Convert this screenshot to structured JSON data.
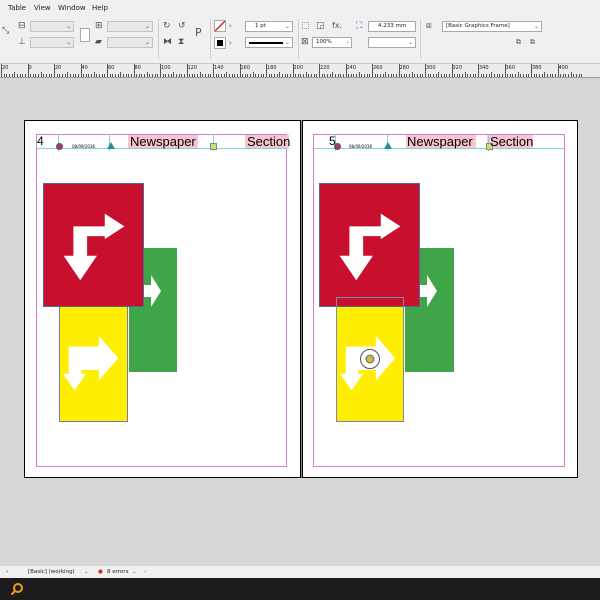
{
  "menu": {
    "items": [
      "Table",
      "View",
      "Window",
      "Help"
    ]
  },
  "control": {
    "stroke_weight": "1 pt",
    "opacity": "100%",
    "dimension": "4.233 mm",
    "object_style": "[Basic Graphics Frame]",
    "fx_label": "fx.",
    "para_glyph": "P"
  },
  "ruler": {
    "ticks": [
      "20",
      "0",
      "20",
      "40",
      "60",
      "80",
      "100",
      "120",
      "140",
      "160",
      "180",
      "200",
      "220",
      "240",
      "260",
      "280",
      "300",
      "320",
      "340",
      "360",
      "380",
      "400"
    ]
  },
  "pages": [
    {
      "number": "4",
      "date": "08/09/2036",
      "title": "Newspaper",
      "section": "Section"
    },
    {
      "number": "5",
      "date": "08/09/2036",
      "title": "Newspaper",
      "section": "Section"
    }
  ],
  "colors": {
    "red": "#c8102e",
    "green": "#3fa548",
    "yellow": "#ffee00",
    "header_highlight": "#f5c6cf",
    "margin_guide": "#d77bd7"
  },
  "status": {
    "style": "[Basic] (working)",
    "errors": "8 errors"
  }
}
